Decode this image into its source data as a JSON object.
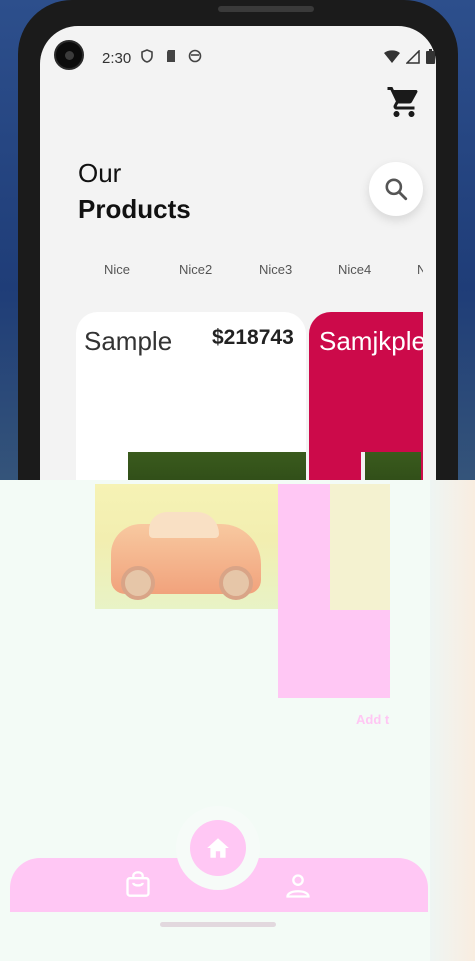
{
  "status_bar": {
    "time": "2:30"
  },
  "header": {
    "title_line1": "Our",
    "title_line2": "Products"
  },
  "categories": [
    "Nice",
    "Nice2",
    "Nice3",
    "Nice4",
    "N"
  ],
  "products": [
    {
      "name": "Sample",
      "price": "$218743"
    },
    {
      "name": "Samjkple"
    }
  ],
  "add_button": {
    "label": "Add t"
  },
  "icons": {
    "cart": "shopping-cart-icon",
    "search": "search-icon",
    "home": "home-icon",
    "bag": "shopping-bag-icon",
    "profile": "person-icon"
  },
  "colors": {
    "accent_pink": "#ffc7f4",
    "card_red": "#cc0a4a",
    "background": "#f3f3f3"
  }
}
